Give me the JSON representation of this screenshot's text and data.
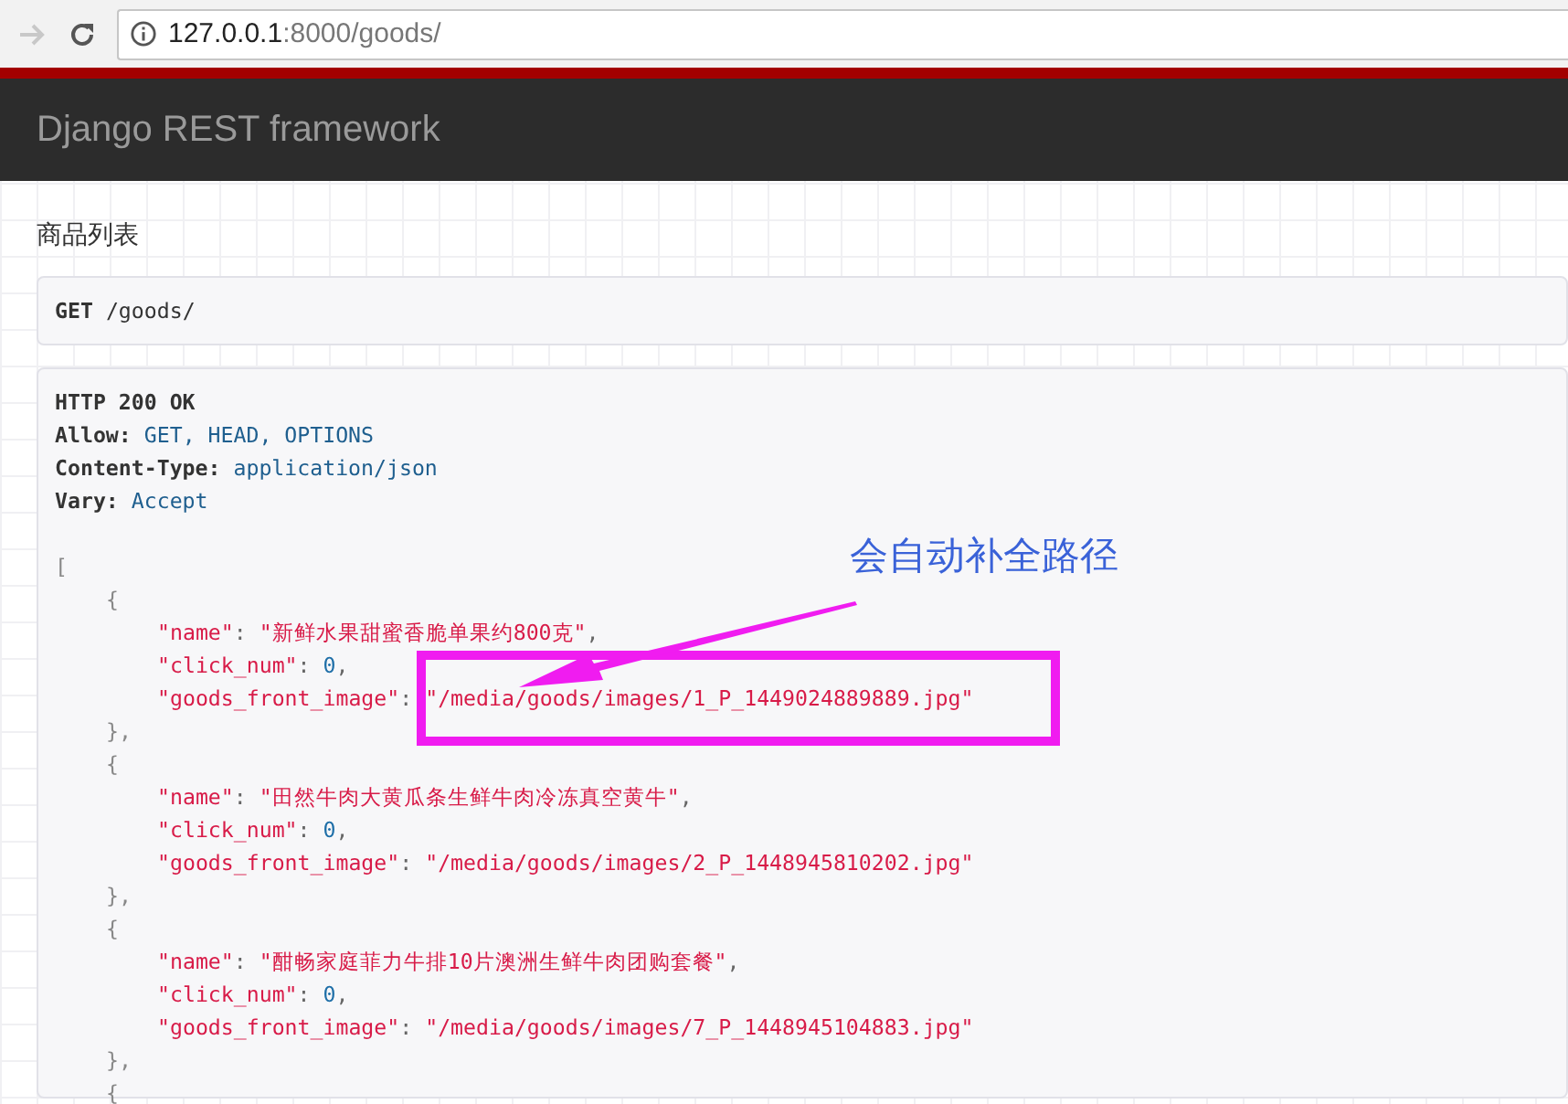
{
  "browser": {
    "address": {
      "host": "127.0.0.1",
      "path": ":8000/goods/"
    }
  },
  "navbar": {
    "brand": "Django REST framework"
  },
  "description": "商品列表",
  "request": {
    "method": "GET",
    "path": "/goods/"
  },
  "response": {
    "status": "HTTP 200 OK",
    "headers": [
      {
        "name": "Allow:",
        "value": "GET, HEAD, OPTIONS"
      },
      {
        "name": "Content-Type:",
        "value": "application/json"
      },
      {
        "name": "Vary:",
        "value": "Accept"
      }
    ],
    "body": {
      "open": "[",
      "items": [
        {
          "open": "{",
          "fields": [
            {
              "key": "\"name\"",
              "sep": ":",
              "value": "\"新鲜水果甜蜜香脆单果约800克\"",
              "kind": "string",
              "trail": ","
            },
            {
              "key": "\"click_num\"",
              "sep": ":",
              "value": "0",
              "kind": "number",
              "trail": ","
            },
            {
              "key": "\"goods_front_image\"",
              "sep": ":",
              "value": "\"/media/goods/images/1_P_1449024889889.jpg\"",
              "kind": "string"
            }
          ],
          "close": "},"
        },
        {
          "open": "{",
          "fields": [
            {
              "key": "\"name\"",
              "sep": ":",
              "value": "\"田然牛肉大黄瓜条生鲜牛肉冷冻真空黄牛\"",
              "kind": "string",
              "trail": ","
            },
            {
              "key": "\"click_num\"",
              "sep": ":",
              "value": "0",
              "kind": "number",
              "trail": ","
            },
            {
              "key": "\"goods_front_image\"",
              "sep": ":",
              "value": "\"/media/goods/images/2_P_1448945810202.jpg\"",
              "kind": "string"
            }
          ],
          "close": "},"
        },
        {
          "open": "{",
          "fields": [
            {
              "key": "\"name\"",
              "sep": ":",
              "value": "\"酣畅家庭菲力牛排10片澳洲生鲜牛肉团购套餐\"",
              "kind": "string",
              "trail": ","
            },
            {
              "key": "\"click_num\"",
              "sep": ":",
              "value": "0",
              "kind": "number",
              "trail": ","
            },
            {
              "key": "\"goods_front_image\"",
              "sep": ":",
              "value": "\"/media/goods/images/7_P_1448945104883.jpg\"",
              "kind": "string"
            }
          ],
          "close": "},"
        },
        {
          "open": "{"
        }
      ]
    }
  },
  "annotation": {
    "text": "会自动补全路径"
  }
}
